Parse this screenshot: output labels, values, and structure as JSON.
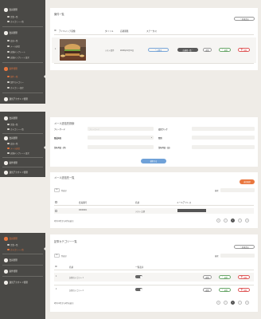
{
  "sidebar": [
    {
      "groups": [
        {
          "label": "会員管理",
          "subs": [
            "企業一覧",
            "カテゴリー一覧"
          ]
        },
        {
          "label": "会員管理",
          "subs": [
            "会員一覧",
            "メール送信",
            "店舗テンプレート",
            "店舗テンプレート設定"
          ]
        },
        {
          "label": "案件管理",
          "subs": [
            "案件一覧",
            "案件カテゴリー",
            "カテゴリー設定"
          ]
        },
        {
          "label": "運営アカウント管理",
          "subs": []
        }
      ]
    },
    {
      "groups": [
        {
          "label": "会員管理",
          "subs": [
            "企業一覧",
            "カテゴリー一覧"
          ]
        },
        {
          "label": "会員管理",
          "subs": [
            "会員一覧",
            "メール送信",
            "店舗テンプレート設定"
          ]
        },
        {
          "label": "案件管理",
          "subs": []
        },
        {
          "label": "運営アカウント管理",
          "subs": []
        }
      ]
    },
    {
      "groups": [
        {
          "label": "会員管理",
          "subs": [
            "企業一覧",
            "カテゴリー一覧"
          ]
        },
        {
          "label": "会員管理",
          "subs": []
        },
        {
          "label": "案件管理",
          "subs": []
        },
        {
          "label": "運営アカウント管理",
          "subs": []
        }
      ]
    }
  ],
  "cases": {
    "title": "案件一覧",
    "new_button": "新規追加",
    "headers": [
      "ID",
      "アイキャッチ画像",
      "タイトル",
      "応募期限",
      "ステータス"
    ],
    "row": {
      "id": "1",
      "title": "テスト案件",
      "deadline": "2020年01月31日",
      "status": "公開中",
      "actions": [
        "応募者一覧",
        "複製",
        "編集",
        "削除"
      ]
    }
  },
  "search": {
    "title": "メール送信先検索",
    "fields_left": [
      {
        "label": "フリーワード",
        "placeholder": "フリーワード"
      },
      {
        "label": "都道府県",
        "placeholder": ""
      },
      {
        "label": "生年月日（月）",
        "placeholder": ""
      }
    ],
    "fields_right": [
      {
        "label": "会員ランク",
        "placeholder": ""
      },
      {
        "label": "性別",
        "placeholder": ""
      },
      {
        "label": "生年月日（日）",
        "placeholder": ""
      }
    ],
    "button": "検索する"
  },
  "mail_list": {
    "title": "メール送信先一覧",
    "send_button": "送信確認",
    "per_page": "50",
    "per_page_label": "件表示",
    "search_label": "検索",
    "headers": [
      "会員番号",
      "名前",
      "メールアドレス"
    ],
    "row": {
      "number": "00000001",
      "name": "テスト 太郎"
    },
    "summary": "1件中1件から1件を表示",
    "pages": [
      "«",
      "‹",
      "1",
      "›",
      "»"
    ]
  },
  "categories": {
    "title": "記事カテゴリー一覧",
    "new_button": "新規追加",
    "per_page": "50",
    "per_page_label": "件表示",
    "search_label": "検索",
    "headers": [
      "ID",
      "名前",
      "一覧表示"
    ],
    "rows": [
      {
        "id": "1",
        "name": "記事カテゴリー１",
        "actions": [
          "複製",
          "編集",
          "削除"
        ]
      },
      {
        "id": "2",
        "name": "記事カテゴリー２",
        "actions": [
          "複製",
          "編集",
          "削除"
        ]
      }
    ],
    "summary": "2件中1件から2件を表示",
    "pages": [
      "«",
      "‹",
      "1",
      "›",
      "»"
    ]
  },
  "colors": {
    "accent": "#e9773f",
    "sidebar": "#4a4946",
    "bg": "#efece7",
    "primary": "#6fa1d8"
  }
}
